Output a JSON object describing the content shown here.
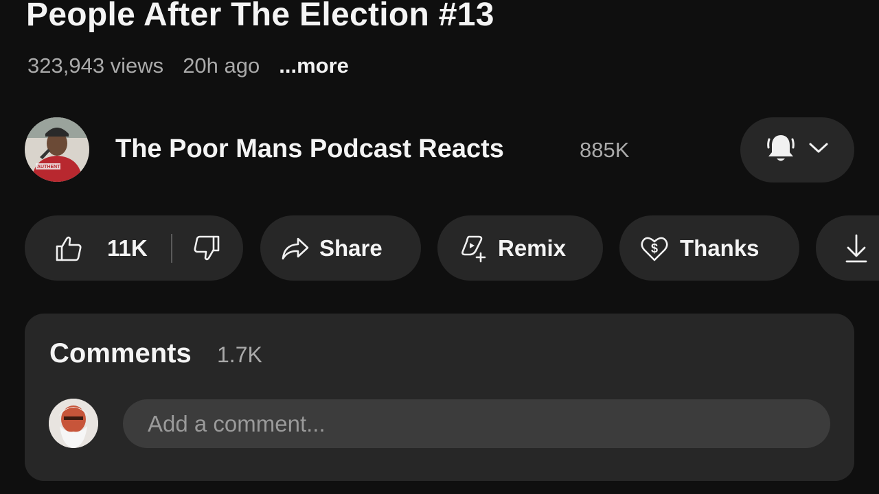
{
  "video": {
    "title": "People After The Election #13",
    "views": "323,943 views",
    "age": "20h ago",
    "more_label": "...more"
  },
  "channel": {
    "name": "The Poor Mans Podcast Reacts",
    "subscribers": "885K",
    "avatar_shirt_text": "AUTHENTIC"
  },
  "actions": {
    "likes": "11K",
    "share_label": "Share",
    "remix_label": "Remix",
    "thanks_label": "Thanks"
  },
  "comments": {
    "title": "Comments",
    "count": "1.7K",
    "placeholder": "Add a comment..."
  },
  "icons": {
    "like": "thumbs-up-icon",
    "dislike": "thumbs-down-icon",
    "share": "share-arrow-icon",
    "remix": "remix-icon",
    "thanks": "heart-dollar-icon",
    "download": "download-icon",
    "bell": "bell-icon",
    "chevron": "chevron-down-icon"
  },
  "colors": {
    "background": "#0f0f0f",
    "surface": "#272727",
    "input": "#3c3c3c",
    "text": "#f1f1f1",
    "muted": "#aaaaaa"
  }
}
